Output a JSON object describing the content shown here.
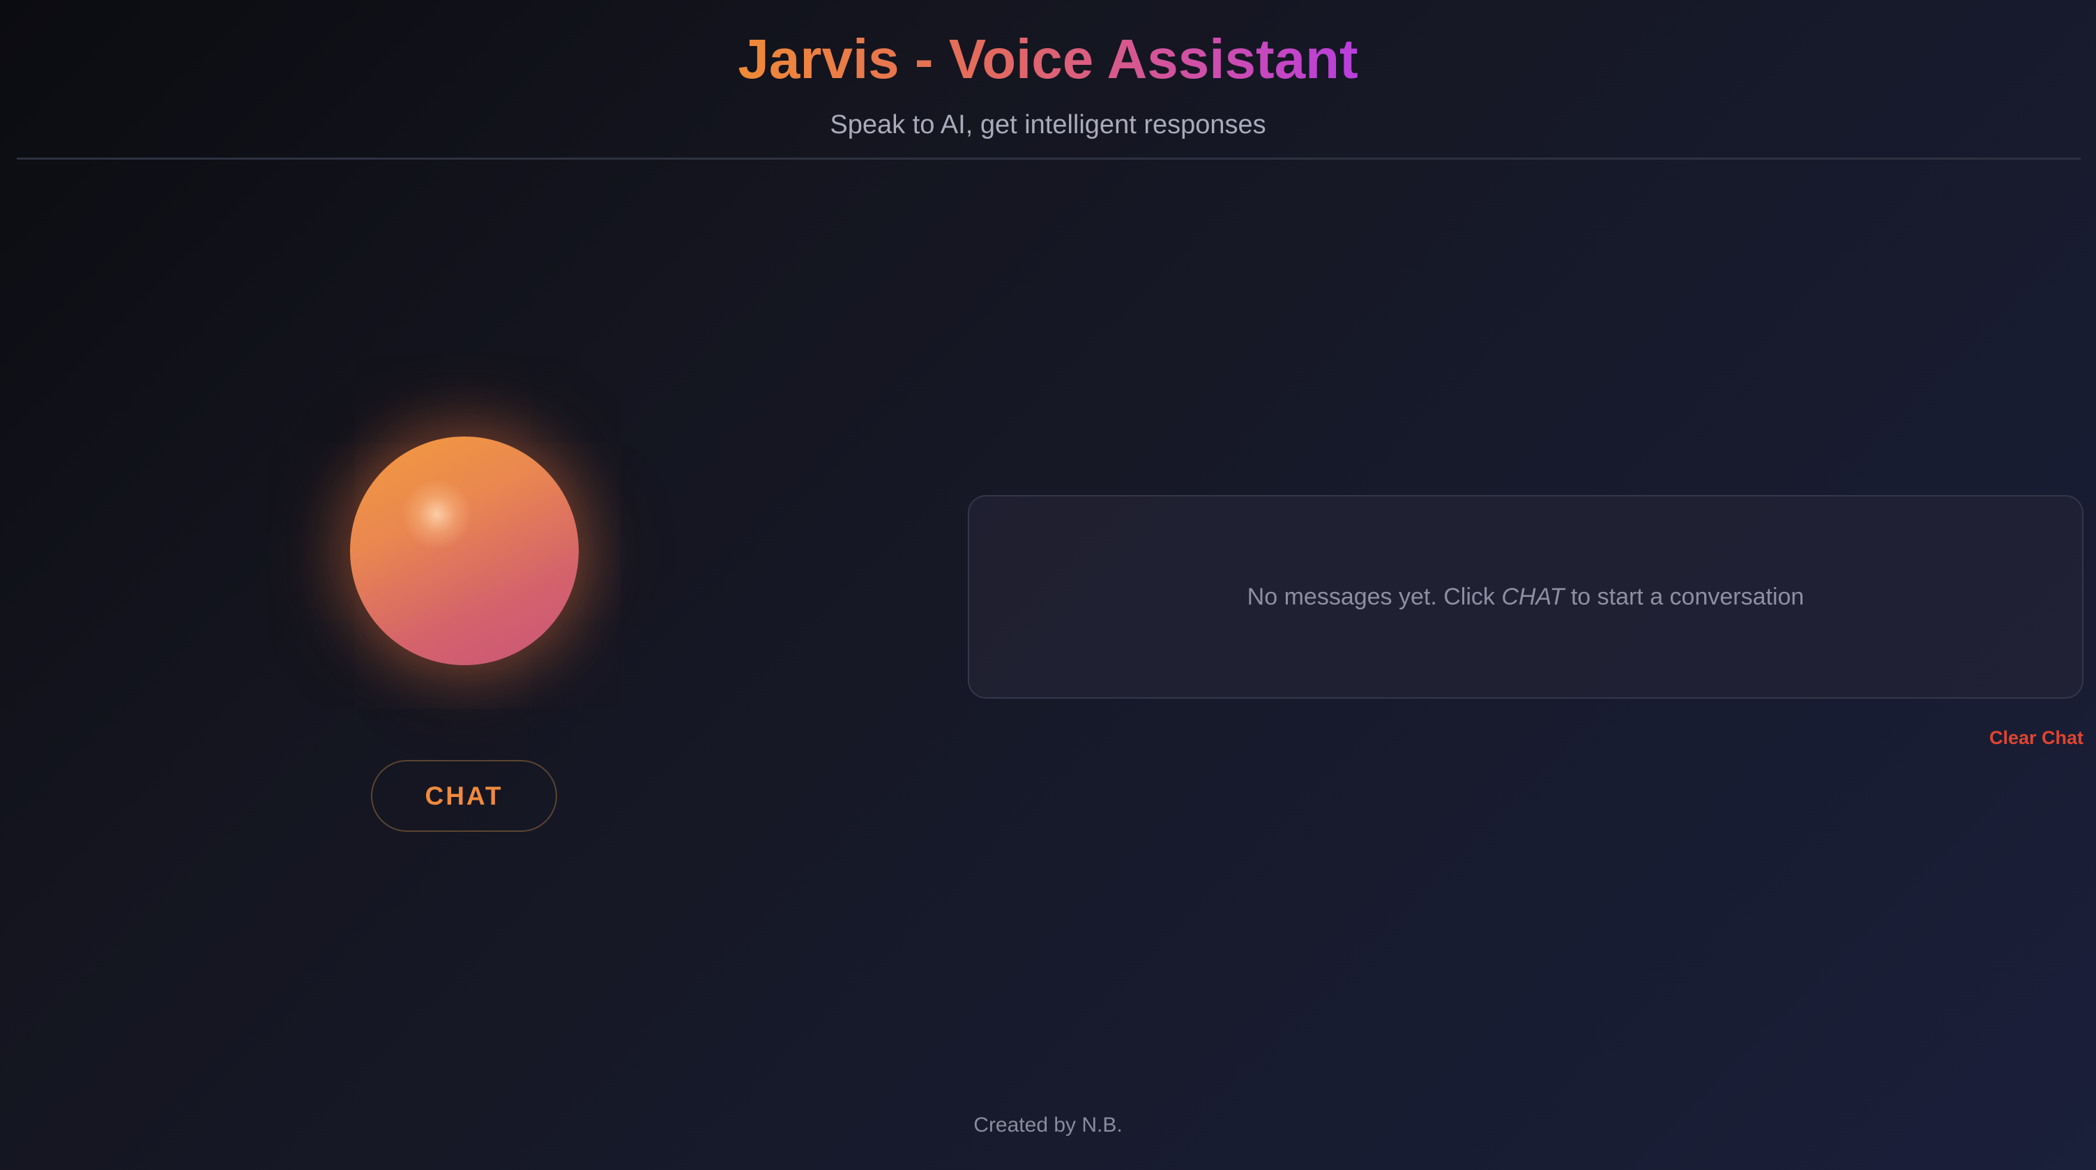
{
  "header": {
    "title": "Jarvis - Voice Assistant",
    "subtitle": "Speak to AI, get intelligent responses"
  },
  "assistant": {
    "orb_icon": "voice-orb",
    "chat_button_label": "CHAT"
  },
  "conversation": {
    "empty_prefix": "No messages yet. Click ",
    "empty_emphasis": "CHAT",
    "empty_suffix": " to start a conversation",
    "clear_label": "Clear Chat"
  },
  "footer": {
    "credit": "Created by N.B."
  },
  "colors": {
    "accent_orange": "#ef8a3f",
    "accent_purple": "#b93ede",
    "danger_red": "#e0452f"
  }
}
